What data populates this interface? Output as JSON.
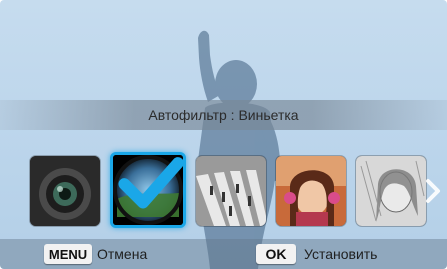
{
  "filter_title": "Автофильтр : Виньетка",
  "thumbnails": [
    {
      "name": "lens",
      "selected": false
    },
    {
      "name": "vignette",
      "selected": true
    },
    {
      "name": "crosswalk",
      "selected": false
    },
    {
      "name": "child-portrait",
      "selected": false
    },
    {
      "name": "sketch",
      "selected": false
    }
  ],
  "bottom_bar": {
    "menu_key": "MENU",
    "menu_label": "Отмена",
    "ok_key": "OK",
    "ok_label": "Установить"
  },
  "colors": {
    "selection": "#1aa7e8",
    "background": "#c6dcee"
  }
}
